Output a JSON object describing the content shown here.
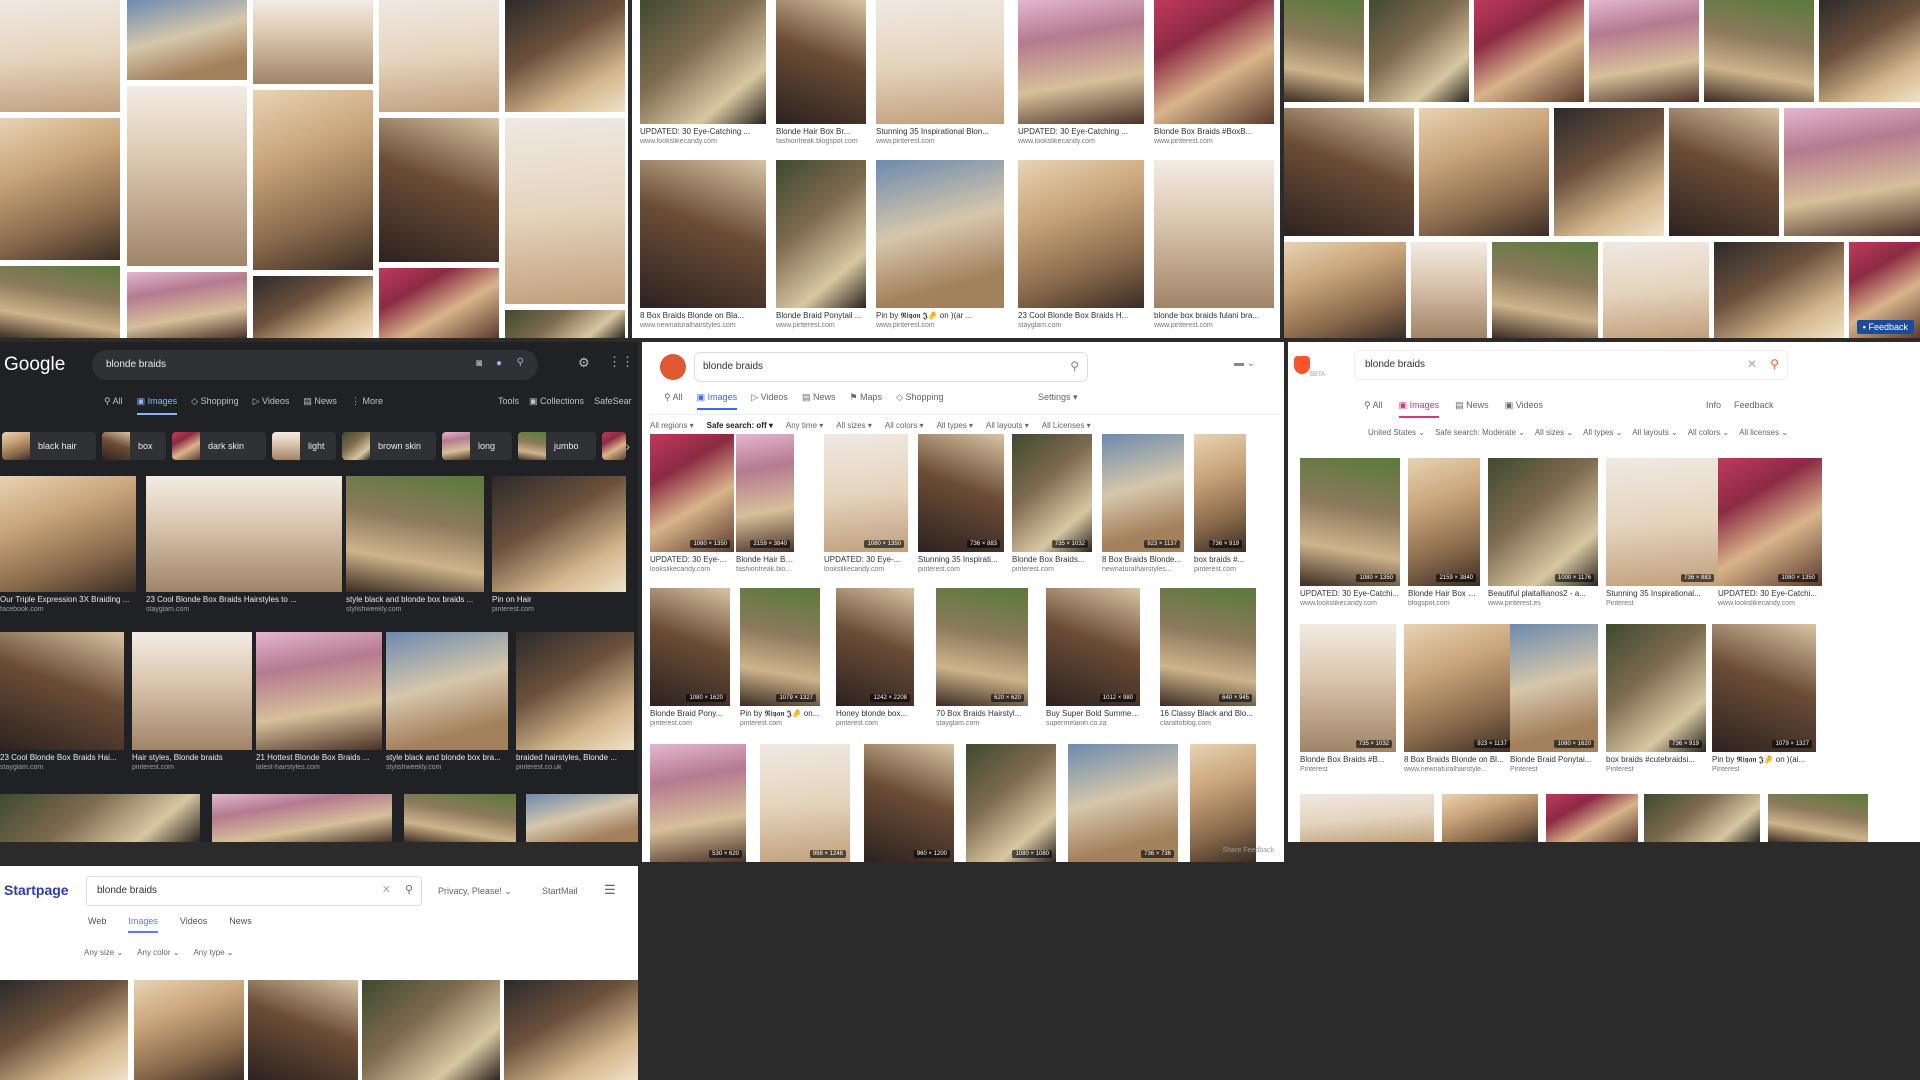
{
  "google": {
    "logo": "Google",
    "query": "blonde braids",
    "tabs": [
      "All",
      "Images",
      "Shopping",
      "Videos",
      "News",
      "More"
    ],
    "tools": "Tools",
    "collections": "Collections",
    "safesearch": "SafeSear",
    "chips": [
      "black hair",
      "box",
      "dark skin",
      "light",
      "brown skin",
      "long",
      "jumbo"
    ],
    "row1": [
      {
        "title": "Our Triple Expression 3X Braiding ...",
        "src": "facebook.com"
      },
      {
        "title": "23 Cool Blonde Box Braids Hairstyles to ...",
        "src": "stayglam.com"
      },
      {
        "title": "style black and blonde box braids ...",
        "src": "stylishweekly.com"
      },
      {
        "title": "Pin on Hair",
        "src": "pinterest.com"
      }
    ],
    "row2": [
      {
        "title": "23 Cool Blonde Box Braids Hai...",
        "src": "stayglam.com"
      },
      {
        "title": "Hair styles, Blonde braids",
        "src": "pinterest.com"
      },
      {
        "title": "21 Hottest Blonde Box Braids ...",
        "src": "latest-hairstyles.com"
      },
      {
        "title": "style black and blonde box bra...",
        "src": "stylishweekly.com"
      },
      {
        "title": "braided hairstyles, Blonde ...",
        "src": "pinterest.co.uk"
      }
    ]
  },
  "ddg": {
    "query": "blonde braids",
    "tabs": [
      "All",
      "Images",
      "Videos",
      "News",
      "Maps",
      "Shopping"
    ],
    "settings": "Settings",
    "filters": [
      "All regions",
      "Safe search: off",
      "Any time",
      "All sizes",
      "All colors",
      "All types",
      "All layouts",
      "All Licenses"
    ],
    "top_caps": [
      {
        "title": "UPDATED: 30 Eye-Catching ...",
        "src": "www.lookslikecandy.com"
      },
      {
        "title": "Blonde Hair Box Br...",
        "src": "fashionfreak.blogspot.com"
      },
      {
        "title": "Stunning 35 Inspirational Blon...",
        "src": "www.pinterest.com"
      },
      {
        "title": "UPDATED: 30 Eye-Catching ...",
        "src": "www.lookslikecandy.com"
      },
      {
        "title": "Blonde Box Braids #BoxB...",
        "src": "www.pinterest.com"
      }
    ],
    "top_caps2": [
      {
        "title": "8 Box Braids Blonde on Bla...",
        "src": "www.newnaturalhairstyles.com"
      },
      {
        "title": "Blonde Braid Ponytail ...",
        "src": "www.pinterest.com"
      },
      {
        "title": "Pin by 𝕽𝖎𝖞𝖆𝖓 𝕵🤌 on )(ar ...",
        "src": "www.pinterest.com"
      },
      {
        "title": "23 Cool Blonde Box Braids H...",
        "src": "stayglam.com"
      },
      {
        "title": "blonde box braids fulani bra...",
        "src": "www.pinterest.com"
      }
    ],
    "row1": [
      {
        "title": "UPDATED: 30 Eye-...",
        "src": "lookslikecandy.com",
        "dim": "1080 × 1350"
      },
      {
        "title": "Blonde Hair Box B...",
        "src": "fashionfreak.blogs...",
        "dim": "2159 × 3840"
      },
      {
        "title": "UPDATED: 30 Eye-...",
        "src": "lookslikecandy.com",
        "dim": "1080 × 1350"
      },
      {
        "title": "Stunning 35 Inspirati...",
        "src": "pinterest.com",
        "dim": "736 × 883"
      },
      {
        "title": "Blonde Box Braids...",
        "src": "pinterest.com",
        "dim": "735 × 1032"
      },
      {
        "title": "8 Box Braids Blonde...",
        "src": "newnaturalhairstyles...",
        "dim": "923 × 1137"
      },
      {
        "title": "box braids #...",
        "src": "pinterest.com",
        "dim": "736 × 919"
      }
    ],
    "row2": [
      {
        "title": "Blonde Braid Pony...",
        "src": "pinterest.com",
        "dim": "1080 × 1620"
      },
      {
        "title": "Pin by 𝕽𝖎𝖞𝖆𝖓 𝕵🤌 on...",
        "src": "pinterest.com",
        "dim": "1079 × 1327"
      },
      {
        "title": "Honey blonde box...",
        "src": "pinterest.com",
        "dim": "1242 × 2208"
      },
      {
        "title": "70 Box Braids Hairstyl...",
        "src": "stayglam.com",
        "dim": "620 × 620"
      },
      {
        "title": "Buy Super Bold Summer Blon...",
        "src": "supermelanin.co.za",
        "dim": "1012 × 980"
      },
      {
        "title": "16 Classy Black and Blo...",
        "src": "claraltoblog.com",
        "dim": "640 × 945"
      }
    ],
    "row3_dims": [
      "530 × 620",
      "998 × 1248",
      "960 × 1200",
      "1080 × 1080",
      "736 × 736",
      ""
    ],
    "share_feedback": "Share Feedback"
  },
  "brave": {
    "query": "blonde braids",
    "beta": "BETA",
    "tabs": [
      "All",
      "Images",
      "News",
      "Videos"
    ],
    "info": "Info",
    "feedback": "Feedback",
    "filters": [
      "United States",
      "Safe search: Moderate",
      "All sizes",
      "All types",
      "All layouts",
      "All colors",
      "All licenses"
    ],
    "feedback_badge": "Feedback",
    "row1": [
      {
        "title": "UPDATED: 30 Eye-Catchi...",
        "src": "www.lookslikecandy.com",
        "dim": "1080 × 1350"
      },
      {
        "title": "Blonde Hair Box B...",
        "src": "blogspot.com",
        "dim": "2159 × 3840"
      },
      {
        "title": "Beautiful plaitallianos2 - a...",
        "src": "www.pinterest.es",
        "dim": "1000 × 1176"
      },
      {
        "title": "Stunning 35 Inspirational...",
        "src": "Pinterest",
        "dim": "736 × 883"
      },
      {
        "title": "UPDATED: 30 Eye-Catchi...",
        "src": "www.lookslikecandy.com",
        "dim": "1080 × 1350"
      }
    ],
    "row2": [
      {
        "title": "Blonde Box Braids #B...",
        "src": "Pinterest",
        "dim": "735 × 1032"
      },
      {
        "title": "8 Box Braids Blonde on Bl...",
        "src": "www.newnaturalhairstyle...",
        "dim": "923 × 1137"
      },
      {
        "title": "Blonde Braid Ponytai...",
        "src": "Pinterest",
        "dim": "1080 × 1620"
      },
      {
        "title": "box braids #cutebraidsi...",
        "src": "Pinterest",
        "dim": "736 × 919"
      },
      {
        "title": "Pin by 𝕽𝖎𝖞𝖆𝖓 𝕵🤌 on )(ai...",
        "src": "Pinterest",
        "dim": "1079 × 1327"
      }
    ]
  },
  "startpage": {
    "logo": "Startpage",
    "query": "blonde braids",
    "privacy": "Privacy, Please!",
    "startmail": "StartMail",
    "tabs": [
      "Web",
      "Images",
      "Videos",
      "News"
    ],
    "filters": [
      "Any size",
      "Any color",
      "Any type"
    ]
  }
}
